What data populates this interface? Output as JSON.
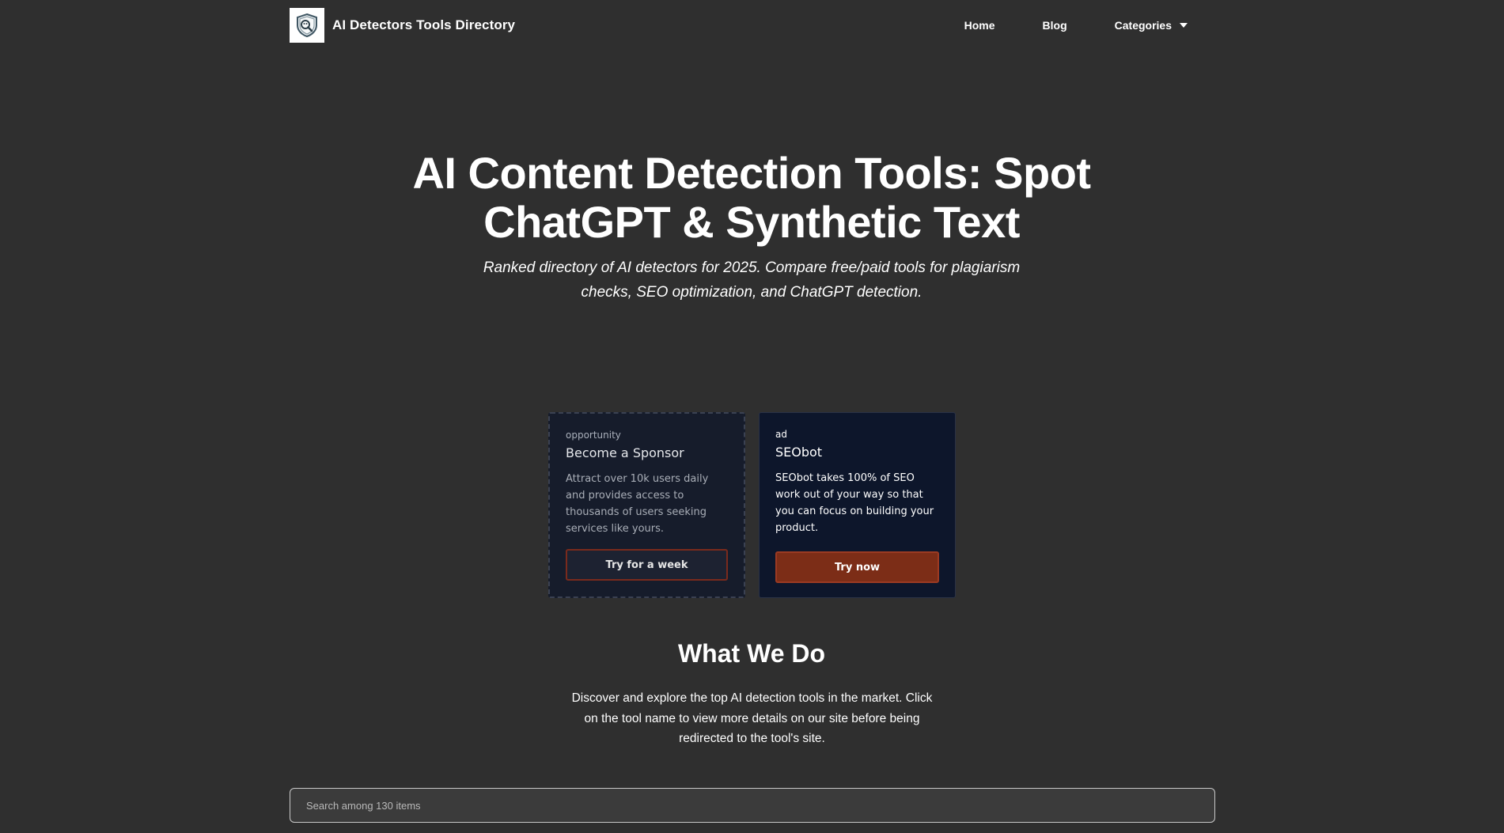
{
  "header": {
    "brand": "AI Detectors Tools Directory",
    "nav": {
      "home": "Home",
      "blog": "Blog",
      "categories": "Categories"
    }
  },
  "hero": {
    "title_line1": "AI Content Detection Tools: Spot",
    "title_line2": "ChatGPT & Synthetic Text",
    "subtitle_line1": "Ranked directory of AI detectors for 2025. Compare free/paid tools for plagiarism",
    "subtitle_line2": "checks, SEO optimization, and ChatGPT detection."
  },
  "cards": {
    "sponsor": {
      "tag": "opportunity",
      "title": "Become a Sponsor",
      "description": "Attract over 10k users daily and provides access to thousands of users seeking services like yours.",
      "button": "Try for a week"
    },
    "ad": {
      "tag": "ad",
      "title": "SEObot",
      "description": "SEObot takes 100% of SEO work out of your way so that you can focus on building your product.",
      "button": "Try now"
    }
  },
  "what_we_do": {
    "title": "What We Do",
    "description": "Discover and explore the top AI detection tools in the market. Click on the tool name to view more details on our site before being redirected to the tool's site."
  },
  "search": {
    "placeholder": "Search among 130 items",
    "value": ""
  },
  "colors": {
    "background": "#2f2f2f",
    "accent": "#7c2d17",
    "card_dark": "#0d162b"
  }
}
